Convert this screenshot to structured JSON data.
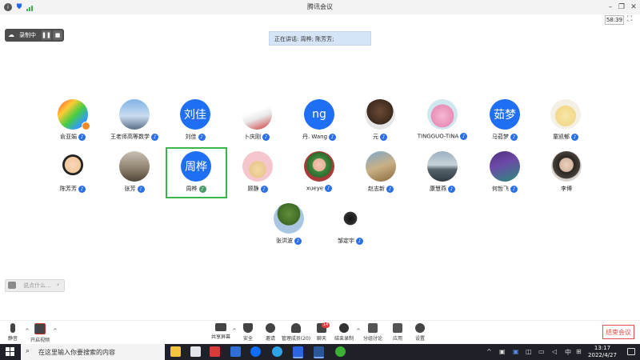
{
  "window": {
    "title": "腾讯会议",
    "timer": "58:39"
  },
  "recording": {
    "label": "录制中"
  },
  "speaking_banner": "正在讲话: 周桦; 陈芳芳;",
  "participants": [
    {
      "name": "俞亚娟",
      "avatar_text": "",
      "mic": "blue"
    },
    {
      "name": "王老师高等数学",
      "avatar_text": "",
      "mic": "blue"
    },
    {
      "name": "刘佳",
      "avatar_text": "刘佳",
      "mic": "blue"
    },
    {
      "name": "卜庆刚",
      "avatar_text": "",
      "mic": "blue"
    },
    {
      "name": "丹. Wang",
      "avatar_text": "ng",
      "mic": "blue"
    },
    {
      "name": "元",
      "avatar_text": "",
      "mic": "blue"
    },
    {
      "name": "TINGGUO-TINA",
      "avatar_text": "",
      "mic": "blue"
    },
    {
      "name": "马茹梦",
      "avatar_text": "茹梦",
      "mic": "blue"
    },
    {
      "name": "童凯郁",
      "avatar_text": "",
      "mic": "blue"
    },
    {
      "name": "陈芳芳",
      "avatar_text": "",
      "mic": "blue"
    },
    {
      "name": "张芳",
      "avatar_text": "",
      "mic": "blue"
    },
    {
      "name": "周桦",
      "avatar_text": "周桦",
      "mic": "green"
    },
    {
      "name": "顾静",
      "avatar_text": "",
      "mic": "blue"
    },
    {
      "name": "xueye",
      "avatar_text": "",
      "mic": "blue"
    },
    {
      "name": "赵志新",
      "avatar_text": "",
      "mic": "blue"
    },
    {
      "name": "康慧燕",
      "avatar_text": "",
      "mic": "blue"
    },
    {
      "name": "何哲飞",
      "avatar_text": "",
      "mic": "blue"
    },
    {
      "name": "李博",
      "avatar_text": "",
      "mic": "none"
    },
    {
      "name": "张洪波",
      "avatar_text": "",
      "mic": "blue"
    },
    {
      "name": "邹定宇",
      "avatar_text": "",
      "mic": "blue"
    }
  ],
  "chat": {
    "placeholder": "说点什么..."
  },
  "toolbar": {
    "mute": "静音",
    "start_video": "开启视频",
    "share_screen": "共享屏幕",
    "security": "安全",
    "invite": "邀请",
    "manage_members": "管理成员(20)",
    "chat": "聊天",
    "chat_badge": "14",
    "end_recording": "结束录制",
    "breakout": "分组讨论",
    "apps": "应用",
    "settings": "设置",
    "end_meeting": "结束会议"
  },
  "taskbar": {
    "search_placeholder": "在这里输入你要搜索的内容",
    "time": "13:17",
    "date": "2022/4/27",
    "ime": "中"
  },
  "colors": {
    "accent": "#1f6ff5",
    "highlight": "#39b54a",
    "end": "#e14c4c"
  }
}
